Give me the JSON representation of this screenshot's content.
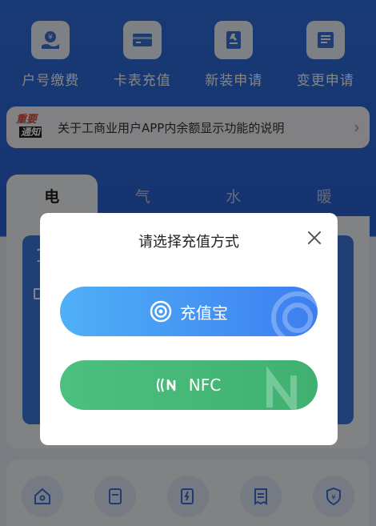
{
  "top_services": [
    {
      "label": "户号缴费",
      "icon": "hand-coin-icon"
    },
    {
      "label": "卡表充值",
      "icon": "card-icon"
    },
    {
      "label": "新装申请",
      "icon": "tool-document-icon"
    },
    {
      "label": "变更申请",
      "icon": "change-document-icon"
    }
  ],
  "notice": {
    "badge_top": "重要",
    "badge_bottom": "通知",
    "text": "关于工商业用户APP内余额显示功能的说明"
  },
  "utility_tabs": [
    "电",
    "气",
    "水",
    "暖"
  ],
  "card": {
    "number": "1"
  },
  "modal": {
    "title": "请选择充值方式",
    "options": [
      {
        "label": "充值宝",
        "icon": "target-circle-icon"
      },
      {
        "label": "NFC",
        "icon": "nfc-icon"
      }
    ]
  },
  "colors": {
    "primary_blue": "#3d7ef0",
    "green": "#3fb070",
    "overlay": "rgba(0,0,0,0.48)"
  }
}
